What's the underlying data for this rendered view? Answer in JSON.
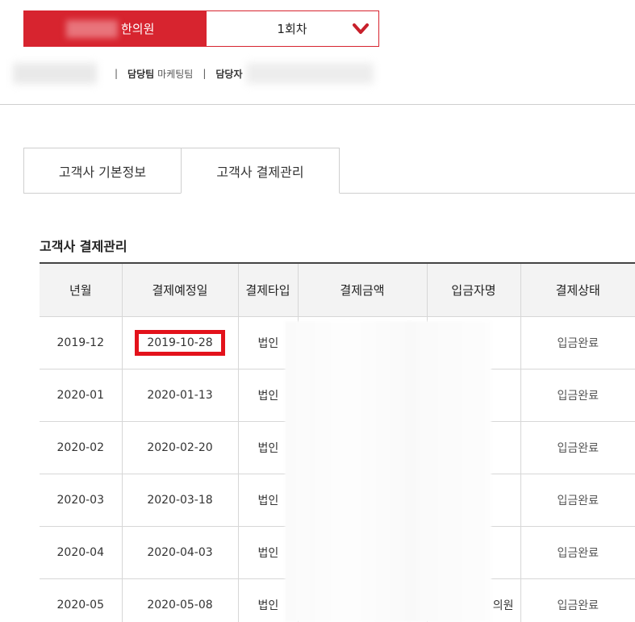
{
  "client": {
    "name": "한의원",
    "round": "1회차"
  },
  "info": {
    "team_key": "담당팀",
    "team_value": "마케팅팀",
    "manager_key": "담당자"
  },
  "tabs": [
    {
      "label": "고객사 기본정보"
    },
    {
      "label": "고객사 결제관리"
    }
  ],
  "section": {
    "title": "고객사 결제관리"
  },
  "table": {
    "headers": [
      "년월",
      "결제예정일",
      "결제타입",
      "결제금액",
      "입금자명",
      "결제상태"
    ],
    "rows": [
      {
        "month": "2019-12",
        "due_date": "2019-10-28",
        "type": "법인",
        "amount": "",
        "depositor": "",
        "status": "입금완료"
      },
      {
        "month": "2020-01",
        "due_date": "2020-01-13",
        "type": "법인",
        "amount": "",
        "depositor": "",
        "status": "입금완료"
      },
      {
        "month": "2020-02",
        "due_date": "2020-02-20",
        "type": "법인",
        "amount": "",
        "depositor": "",
        "status": "입금완료"
      },
      {
        "month": "2020-03",
        "due_date": "2020-03-18",
        "type": "법인",
        "amount": "",
        "depositor": "",
        "status": "입금완료"
      },
      {
        "month": "2020-04",
        "due_date": "2020-04-03",
        "type": "법인",
        "amount": "",
        "depositor": "",
        "status": "입금완료"
      },
      {
        "month": "2020-05",
        "due_date": "2020-05-08",
        "type": "법인",
        "amount": "",
        "depositor": "의원",
        "status": "입금완료"
      }
    ]
  },
  "colors": {
    "accent": "#d7242f",
    "highlight_border": "#e3121b",
    "header_bg": "#f3f3f3"
  },
  "icons": {
    "round_dropdown": "chevron-down-icon"
  }
}
